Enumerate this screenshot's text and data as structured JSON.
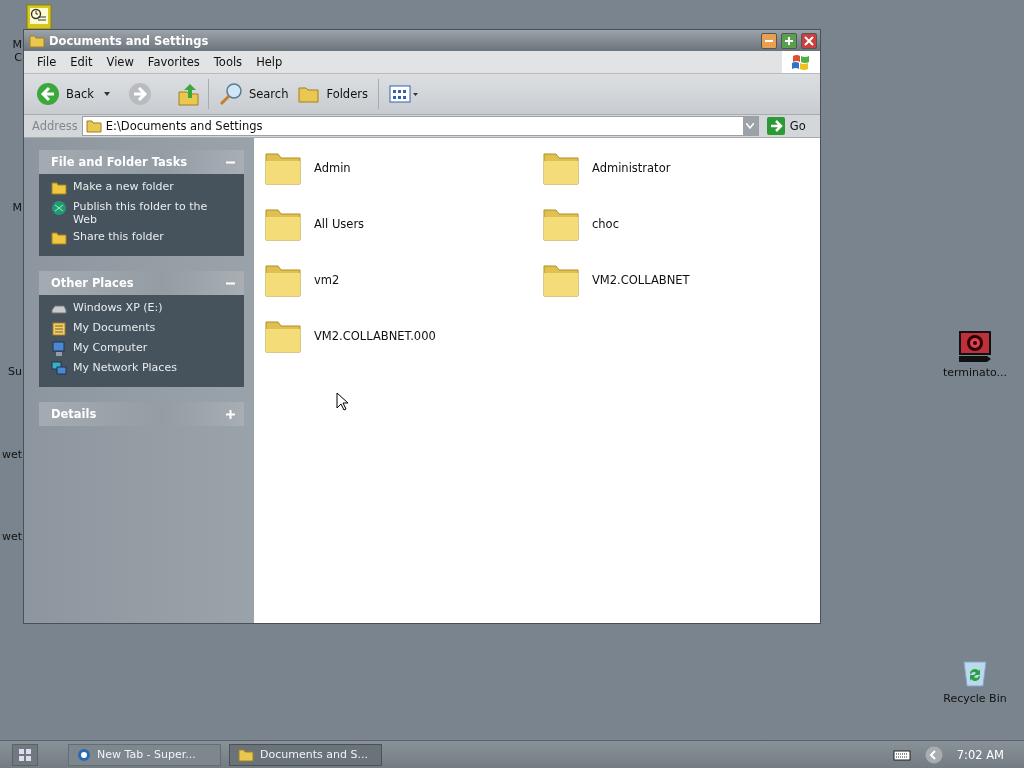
{
  "desktop": {
    "partial_labels": [
      "M",
      "C",
      "M",
      "Su",
      "wet",
      "wet"
    ],
    "icons": [
      {
        "kind": "video",
        "label": "terminato..."
      },
      {
        "kind": "recycle",
        "label": "Recycle Bin"
      }
    ]
  },
  "window": {
    "title": "Documents and Settings",
    "menu": [
      "File",
      "Edit",
      "View",
      "Favorites",
      "Tools",
      "Help"
    ],
    "toolbar": {
      "back": "Back",
      "search": "Search",
      "folders": "Folders"
    },
    "address": {
      "label": "Address",
      "value": "E:\\Documents and Settings",
      "go": "Go"
    },
    "panels": [
      {
        "title": "File and Folder Tasks",
        "expanded": true,
        "items": [
          {
            "kind": "newfolder",
            "label": "Make a new folder"
          },
          {
            "kind": "publish",
            "label": "Publish this folder to the Web"
          },
          {
            "kind": "share",
            "label": "Share this folder"
          }
        ]
      },
      {
        "title": "Other Places",
        "expanded": true,
        "items": [
          {
            "kind": "drive",
            "label": "Windows XP (E:)"
          },
          {
            "kind": "docs",
            "label": "My Documents"
          },
          {
            "kind": "computer",
            "label": "My Computer"
          },
          {
            "kind": "network",
            "label": "My Network Places"
          }
        ]
      },
      {
        "title": "Details",
        "expanded": false
      }
    ],
    "folders": [
      "Admin",
      "Administrator",
      "All Users",
      "choc",
      "vm2",
      "VM2.COLLABNET",
      "VM2.COLLABNET.000"
    ]
  },
  "taskbar": {
    "buttons": [
      {
        "kind": "browser",
        "label": "New Tab - Super...",
        "selected": false
      },
      {
        "kind": "folder",
        "label": "Documents and S...",
        "selected": true
      }
    ],
    "clock": "7:02 AM"
  }
}
